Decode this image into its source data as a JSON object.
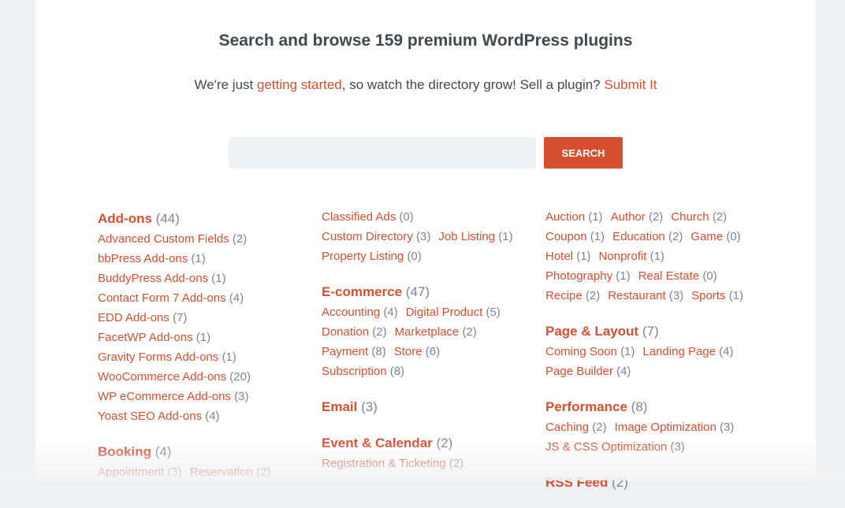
{
  "header": {
    "title": "Search and browse 159 premium WordPress plugins",
    "sub_pre": "We're just ",
    "sub_link": "getting started",
    "sub_mid": ", so watch the directory grow! Sell a plugin? ",
    "sub_link2": "Submit It"
  },
  "search": {
    "placeholder": "",
    "button": "SEARCH"
  },
  "colors": {
    "accent": "#d64f2f",
    "count": "#7a8690",
    "text": "#3d4a52"
  },
  "columns": [
    [
      {
        "name": "Add-ons",
        "count": "(44)",
        "rows": [
          [
            [
              "Advanced Custom Fields",
              "(2)"
            ]
          ],
          [
            [
              "bbPress Add-ons",
              "(1)"
            ]
          ],
          [
            [
              "BuddyPress Add-ons",
              "(1)"
            ]
          ],
          [
            [
              "Contact Form 7 Add-ons",
              "(4)"
            ]
          ],
          [
            [
              "EDD Add-ons",
              "(7)"
            ]
          ],
          [
            [
              "FacetWP Add-ons",
              "(1)"
            ]
          ],
          [
            [
              "Gravity Forms Add-ons",
              "(1)"
            ]
          ],
          [
            [
              "WooCommerce Add-ons",
              "(20)"
            ]
          ],
          [
            [
              "WP eCommerce Add-ons",
              "(3)"
            ]
          ],
          [
            [
              "Yoast SEO Add-ons",
              "(4)"
            ]
          ]
        ]
      },
      {
        "name": "Booking",
        "count": "(4)",
        "rows": [
          [
            [
              "Appointment",
              "(3)"
            ],
            [
              "Reservation",
              "(2)"
            ]
          ]
        ]
      }
    ],
    [
      {
        "name": "",
        "count": "",
        "rows": [
          [
            [
              "Classified Ads",
              "(0)"
            ]
          ],
          [
            [
              "Custom Directory",
              "(3)"
            ],
            [
              "Job Listing",
              "(1)"
            ]
          ],
          [
            [
              "Property Listing",
              "(0)"
            ]
          ]
        ]
      },
      {
        "name": "E-commerce",
        "count": "(47)",
        "rows": [
          [
            [
              "Accounting",
              "(4)"
            ],
            [
              "Digital Product",
              "(5)"
            ]
          ],
          [
            [
              "Donation",
              "(2)"
            ],
            [
              "Marketplace",
              "(2)"
            ]
          ],
          [
            [
              "Payment",
              "(8)"
            ],
            [
              "Store",
              "(6)"
            ]
          ],
          [
            [
              "Subscription",
              "(8)"
            ]
          ]
        ]
      },
      {
        "name": "Email",
        "count": "(3)",
        "rows": []
      },
      {
        "name": "Event & Calendar",
        "count": "(2)",
        "rows": [
          [
            [
              "Registration & Ticketing",
              "(2)"
            ]
          ]
        ]
      }
    ],
    [
      {
        "name": "",
        "count": "",
        "rows": [
          [
            [
              "Auction",
              "(1)"
            ],
            [
              "Author",
              "(2)"
            ],
            [
              "Church",
              "(2)"
            ]
          ],
          [
            [
              "Coupon",
              "(1)"
            ],
            [
              "Education",
              "(2)"
            ],
            [
              "Game",
              "(0)"
            ]
          ],
          [
            [
              "Hotel",
              "(1)"
            ],
            [
              "Nonprofit",
              "(1)"
            ]
          ],
          [
            [
              "Photography",
              "(1)"
            ],
            [
              "Real Estate",
              "(0)"
            ]
          ],
          [
            [
              "Recipe",
              "(2)"
            ],
            [
              "Restaurant",
              "(3)"
            ],
            [
              "Sports",
              "(1)"
            ]
          ]
        ]
      },
      {
        "name": "Page & Layout",
        "count": "(7)",
        "rows": [
          [
            [
              "Coming Soon",
              "(1)"
            ],
            [
              "Landing Page",
              "(4)"
            ]
          ],
          [
            [
              "Page Builder",
              "(4)"
            ]
          ]
        ]
      },
      {
        "name": "Performance",
        "count": "(8)",
        "rows": [
          [
            [
              "Caching",
              "(2)"
            ],
            [
              "Image Optimization",
              "(3)"
            ]
          ],
          [
            [
              "JS & CSS Optimization",
              "(3)"
            ]
          ]
        ]
      },
      {
        "name": "RSS Feed",
        "count": "(2)",
        "rows": []
      }
    ]
  ]
}
